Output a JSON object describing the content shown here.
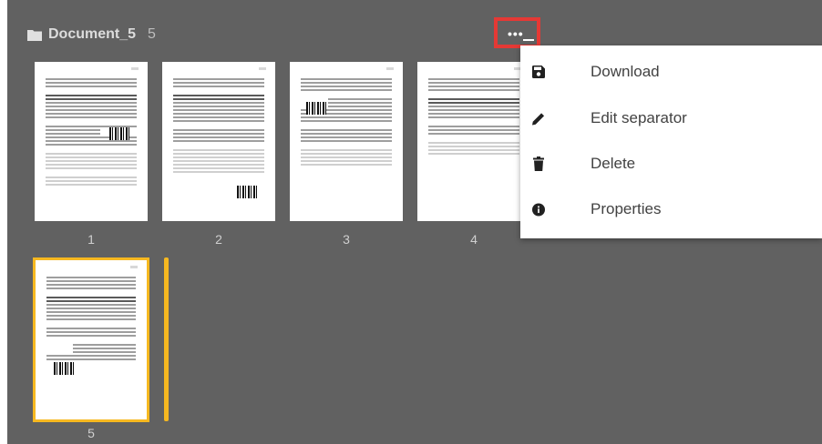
{
  "document": {
    "title": "Document_5",
    "page_count": "5"
  },
  "more_button": {
    "icon": "ellipsis-icon"
  },
  "pages": [
    {
      "number": "1"
    },
    {
      "number": "2"
    },
    {
      "number": "3"
    },
    {
      "number": "4"
    },
    {
      "number": "5",
      "selected": true
    }
  ],
  "menu": {
    "items": [
      {
        "label": "Download",
        "icon": "save-icon"
      },
      {
        "label": "Edit separator",
        "icon": "pencil-icon"
      },
      {
        "label": "Delete",
        "icon": "trash-icon"
      },
      {
        "label": "Properties",
        "icon": "info-icon"
      }
    ]
  },
  "colors": {
    "background": "#616161",
    "accent": "#f6b820",
    "highlight": "#e53935"
  }
}
